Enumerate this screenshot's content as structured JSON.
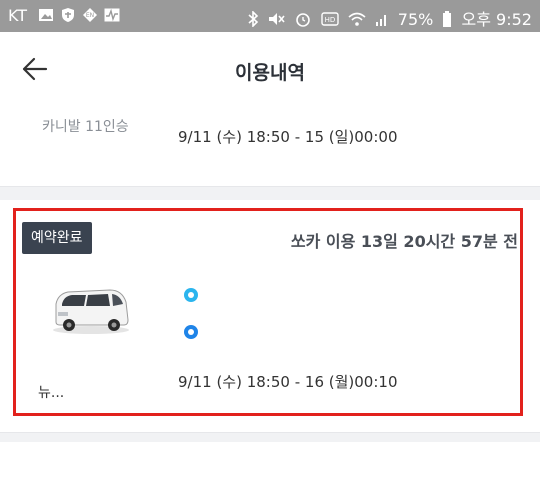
{
  "status_bar": {
    "carrier": "KT",
    "battery": "75%",
    "time": "오후 9:52",
    "icons": [
      "image-icon",
      "shield-icon",
      "en-icon",
      "activity-icon",
      "bluetooth-icon",
      "mute-icon",
      "alarm-icon",
      "hd-icon",
      "wifi-icon",
      "signal-icon",
      "battery-icon"
    ]
  },
  "header": {
    "title": "이용내역",
    "back_icon": "arrow-left-icon"
  },
  "prev_card": {
    "car_name": "카니발 11인승",
    "time_range": "9/11 (수) 18:50 - 15 (일)00:00"
  },
  "card": {
    "status_badge": "예약완료",
    "usage_summary": "쏘카 이용 13일 20시간 57분 전",
    "car_name": "뉴...",
    "time_range": "9/11 (수) 18:50 - 16 (월)00:10",
    "colors": {
      "start_dot": "#2bb5ee",
      "end_dot": "#1f84e8",
      "badge_bg": "#3a4350",
      "highlight": "#e2211c"
    }
  }
}
